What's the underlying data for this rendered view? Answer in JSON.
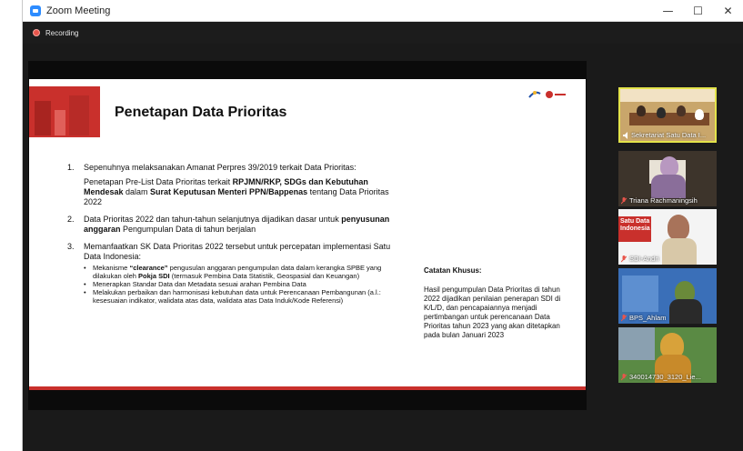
{
  "window": {
    "title": "Zoom Meeting",
    "controls": {
      "minimize": "—",
      "maximize": "☐",
      "close": "✕"
    }
  },
  "recording": {
    "label": "Recording"
  },
  "slide": {
    "title": "Penetapan Data Prioritas",
    "items": [
      {
        "num": "1.",
        "para1": "Sepenuhnya melaksanakan Amanat Perpres 39/2019 terkait Data Prioritas:",
        "para2_parts": {
          "a": "Penetapan Pre-List Data Prioritas terkait ",
          "b": "RPJMN/RKP, SDGs dan Kebutuhan Mendesak",
          "c": " dalam ",
          "d": "Surat Keputusan Menteri PPN/Bappenas",
          "e": " tentang Data Prioritas 2022"
        }
      },
      {
        "num": "2.",
        "parts": {
          "a": "Data Prioritas 2022 dan tahun-tahun selanjutnya dijadikan dasar untuk ",
          "b": "penyusunan anggaran",
          "c": " Pengumpulan Data di tahun berjalan"
        }
      },
      {
        "num": "3.",
        "text": "Memanfaatkan SK Data Prioritas 2022 tersebut untuk percepatan implementasi Satu Data Indonesia:",
        "bullets": [
          {
            "a": "Mekanisme ",
            "b": "“clearance”",
            "c": " pengusulan anggaran pengumpulan data dalam kerangka SPBE yang dilakukan oleh ",
            "d": "Pokja SDI",
            "e": " (termasuk Pembina Data Statistik, Geospasial dan Keuangan)"
          },
          {
            "a": "Menerapkan Standar Data dan Metadata sesuai arahan Pembina Data",
            "b": "",
            "c": "",
            "d": "",
            "e": ""
          },
          {
            "a": "Melakukan perbaikan dan harmonisasi kebutuhan data untuk Perencanaan Pembangunan (a.l.: kesesuaian indikator, walidata atas data, walidata atas Data Induk/Kode Referensi)",
            "b": "",
            "c": "",
            "d": "",
            "e": ""
          }
        ]
      }
    ],
    "note": {
      "heading": "Catatan Khusus:",
      "body": "Hasil pengumpulan Data Prioritas di tahun 2022 dijadikan penilaian penerapan SDI di K/L/D, dan pencapaiannya menjadi pertimbangan untuk perencanaan Data Prioritas tahun 2023 yang akan ditetapkan pada bulan Januari 2023"
    }
  },
  "participants": [
    {
      "name": "Sekretariat Satu Data I...",
      "icon": "speaker-icon",
      "active": true
    },
    {
      "name": "Triana Rachmaningsih",
      "icon": "mic-muted-icon",
      "active": false
    },
    {
      "name": "SDI-Andri",
      "icon": "mic-muted-icon",
      "active": false,
      "overlay": "Satu Data Indonesia"
    },
    {
      "name": "BPS_Ahlam",
      "icon": "mic-muted-icon",
      "active": false
    },
    {
      "name": "340014730_3120_Lie...",
      "icon": "mic-muted-icon",
      "active": false
    }
  ],
  "colors": {
    "accent_red": "#c9302c",
    "active_speaker": "#e3e34a",
    "zoom_blue": "#2d8cff"
  }
}
